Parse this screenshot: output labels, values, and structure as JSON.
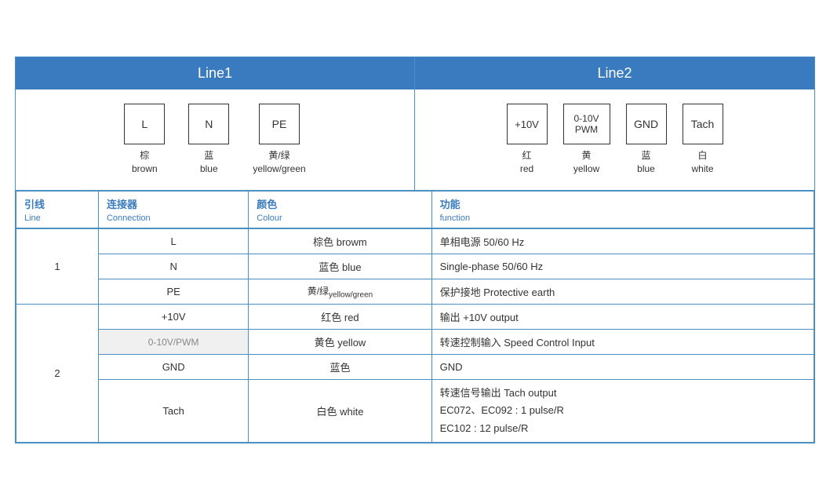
{
  "header": {
    "line1": "Line1",
    "line2": "Line2"
  },
  "diagram": {
    "line1": {
      "connectors": [
        {
          "label": "L",
          "color_zh": "棕",
          "color_en": "brown"
        },
        {
          "label": "N",
          "color_zh": "蓝",
          "color_en": "blue"
        },
        {
          "label": "PE",
          "color_zh": "黄/绿",
          "color_en": "yellow/green"
        }
      ]
    },
    "line2": {
      "connectors": [
        {
          "label": "+10V",
          "color_zh": "红",
          "color_en": "red"
        },
        {
          "label": "0-10V\nPWM",
          "color_zh": "黄",
          "color_en": "yellow"
        },
        {
          "label": "GND",
          "color_zh": "蓝",
          "color_en": "blue"
        },
        {
          "label": "Tach",
          "color_zh": "白",
          "color_en": "white"
        }
      ]
    }
  },
  "table": {
    "col_headers": [
      {
        "zh": "引线",
        "en": "Line"
      },
      {
        "zh": "连接器",
        "en": "Connection"
      },
      {
        "zh": "颜色",
        "en": "Colour"
      },
      {
        "zh": "功能",
        "en": "function"
      }
    ],
    "rows": [
      {
        "line": "1",
        "rowspan": 3,
        "entries": [
          {
            "connection": "L",
            "colour": "棕色 browm",
            "function": "单相电源 50/60 Hz"
          },
          {
            "connection": "N",
            "colour": "蓝色 blue",
            "function": "Single-phase 50/60 Hz"
          },
          {
            "connection": "PE",
            "colour": "黄/绿 yellow/green",
            "function": "保护接地 Protective earth"
          }
        ]
      },
      {
        "line": "2",
        "rowspan": 4,
        "entries": [
          {
            "connection": "+10V",
            "colour": "红色 red",
            "function": "输出 +10V output"
          },
          {
            "connection": "0-10V/PWM",
            "colour": "黄色 yellow",
            "function": "转速控制输入 Speed Control Input"
          },
          {
            "connection": "GND",
            "colour": "蓝色",
            "function": "GND"
          },
          {
            "connection": "Tach",
            "colour": "白色 white",
            "function": "转速信号输出 Tach output\nEC072、EC092 : 1 pulse/R\nEC102 : 12 pulse/R"
          }
        ]
      }
    ]
  }
}
